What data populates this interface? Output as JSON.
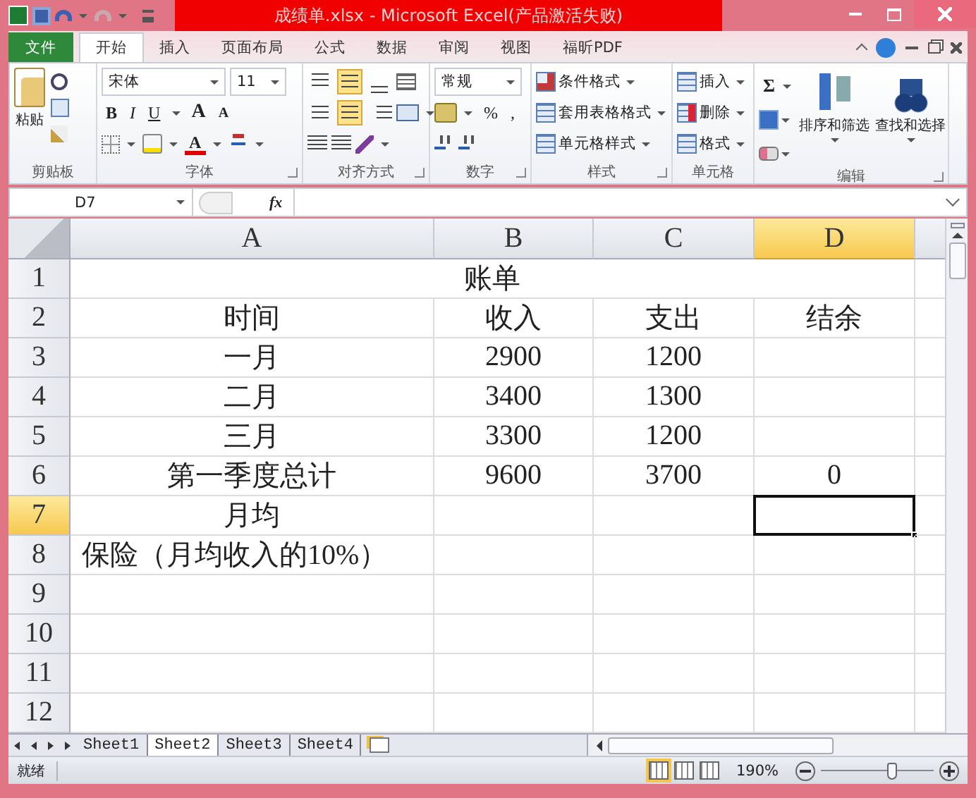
{
  "window": {
    "title": "成绩单.xlsx - Microsoft Excel(产品激活失败)"
  },
  "tabs": [
    {
      "label": "文件",
      "kind": "file",
      "selected": false
    },
    {
      "label": "开始",
      "kind": "tab",
      "selected": true
    },
    {
      "label": "插入",
      "kind": "tab",
      "selected": false
    },
    {
      "label": "页面布局",
      "kind": "tab",
      "selected": false
    },
    {
      "label": "公式",
      "kind": "tab",
      "selected": false
    },
    {
      "label": "数据",
      "kind": "tab",
      "selected": false
    },
    {
      "label": "审阅",
      "kind": "tab",
      "selected": false
    },
    {
      "label": "视图",
      "kind": "tab",
      "selected": false
    },
    {
      "label": "福昕PDF",
      "kind": "tab",
      "selected": false
    }
  ],
  "ribbon": {
    "clipboard": {
      "label": "剪贴板",
      "paste": "粘贴"
    },
    "font": {
      "label": "字体",
      "font_name": "宋体",
      "font_size": "11",
      "styles": [
        "B",
        "I",
        "U"
      ],
      "grow": "A",
      "shrink": "A",
      "font_color_label": "A"
    },
    "alignment": {
      "label": "对齐方式"
    },
    "number": {
      "label": "数字",
      "format": "常规",
      "percent": "%",
      "comma": ","
    },
    "styles": {
      "label": "样式",
      "items": [
        "条件格式",
        "套用表格格式",
        "单元格样式"
      ]
    },
    "cells": {
      "label": "单元格",
      "items": [
        "插入",
        "删除",
        "格式"
      ]
    },
    "editing": {
      "label": "编辑",
      "sum": "Σ",
      "buttons": [
        "排序和筛选",
        "查找和选择"
      ]
    }
  },
  "formula_bar": {
    "name_box": "D7",
    "fx": "fx"
  },
  "columns": [
    {
      "label": "A",
      "selected": false
    },
    {
      "label": "B",
      "selected": false
    },
    {
      "label": "C",
      "selected": false
    },
    {
      "label": "D",
      "selected": true
    }
  ],
  "rows": [
    {
      "number": "1",
      "selected": false,
      "title": "账单"
    },
    {
      "number": "2",
      "selected": false,
      "cells": {
        "A": {
          "text": "时间"
        },
        "B": {
          "text": "收入"
        },
        "C": {
          "text": "支出"
        },
        "D": {
          "text": "结余"
        }
      }
    },
    {
      "number": "3",
      "selected": false,
      "cells": {
        "A": {
          "text": "一月"
        },
        "B": {
          "text": "2900"
        },
        "C": {
          "text": "1200"
        }
      }
    },
    {
      "number": "4",
      "selected": false,
      "cells": {
        "A": {
          "text": "二月"
        },
        "B": {
          "text": "3400"
        },
        "C": {
          "text": "1300"
        }
      }
    },
    {
      "number": "5",
      "selected": false,
      "cells": {
        "A": {
          "text": "三月"
        },
        "B": {
          "text": "3300"
        },
        "C": {
          "text": "1200"
        }
      }
    },
    {
      "number": "6",
      "selected": false,
      "cells": {
        "A": {
          "text": "第一季度总计"
        },
        "B": {
          "text": "9600"
        },
        "C": {
          "text": "3700"
        },
        "D": {
          "text": "0"
        }
      }
    },
    {
      "number": "7",
      "selected": true,
      "cells": {
        "A": {
          "text": "月均"
        },
        "D": {
          "active": true
        }
      }
    },
    {
      "number": "8",
      "selected": false,
      "cells": {
        "A": {
          "text": "保险（月均收入的10%）",
          "left_aligned": true
        }
      }
    },
    {
      "number": "9",
      "selected": false
    },
    {
      "number": "10",
      "selected": false
    },
    {
      "number": "11",
      "selected": false
    },
    {
      "number": "12",
      "selected": false
    }
  ],
  "sheets": [
    {
      "label": "Sheet1",
      "selected": false
    },
    {
      "label": "Sheet2",
      "selected": true
    },
    {
      "label": "Sheet3",
      "selected": false
    },
    {
      "label": "Sheet4",
      "selected": false
    }
  ],
  "status_bar": {
    "status": "就绪",
    "zoom": "190%",
    "zoom_slider": {
      "level": 0.62
    }
  }
}
